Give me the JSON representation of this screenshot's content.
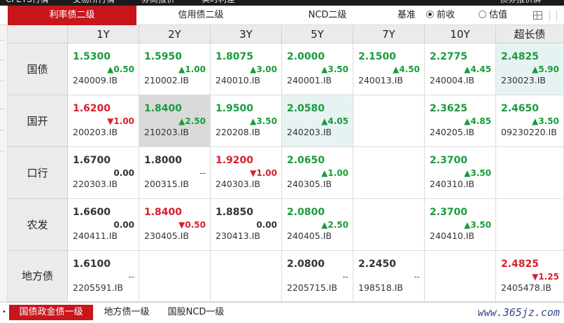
{
  "top_nav": [
    "CFETS行情",
    "交易所行情",
    "券商报价",
    "实时利差",
    "债券报价屏"
  ],
  "tabs": [
    {
      "label": "利率债二级",
      "active": true
    },
    {
      "label": "信用债二级",
      "active": false
    },
    {
      "label": "NCD二级",
      "active": false
    }
  ],
  "basis": {
    "label": "基准",
    "options": [
      {
        "label": "前收",
        "selected": true
      },
      {
        "label": "估值",
        "selected": false
      }
    ]
  },
  "columns": [
    "1Y",
    "2Y",
    "3Y",
    "5Y",
    "7Y",
    "10Y",
    "超长债"
  ],
  "rows": [
    {
      "label": "国债",
      "cells": [
        {
          "yield": "1.5300",
          "change": "▲0.50",
          "dir": "up",
          "code": "240009.IB"
        },
        {
          "yield": "1.5950",
          "change": "▲1.00",
          "dir": "up",
          "code": "210002.IB"
        },
        {
          "yield": "1.8075",
          "change": "▲3.00",
          "dir": "up",
          "code": "240010.IB"
        },
        {
          "yield": "2.0000",
          "change": "▲3.50",
          "dir": "up",
          "code": "240001.IB"
        },
        {
          "yield": "2.1500",
          "change": "▲4.50",
          "dir": "up",
          "code": "240013.IB"
        },
        {
          "yield": "2.2775",
          "change": "▲4.45",
          "dir": "up",
          "code": "240004.IB"
        },
        {
          "yield": "2.4825",
          "change": "▲5.90",
          "dir": "up",
          "code": "230023.IB",
          "hl": "teal"
        }
      ]
    },
    {
      "label": "国开",
      "cells": [
        {
          "yield": "1.6200",
          "change": "▼1.00",
          "dir": "dn",
          "code": "200203.IB"
        },
        {
          "yield": "1.8400",
          "change": "▲2.50",
          "dir": "up",
          "code": "210203.IB",
          "hl": "gray"
        },
        {
          "yield": "1.9500",
          "change": "▲3.50",
          "dir": "up",
          "code": "220208.IB"
        },
        {
          "yield": "2.0580",
          "change": "▲4.05",
          "dir": "up",
          "code": "240203.IB",
          "hl": "teal"
        },
        null,
        {
          "yield": "2.3625",
          "change": "▲4.85",
          "dir": "up",
          "code": "240205.IB"
        },
        {
          "yield": "2.4650",
          "change": "▲3.50",
          "dir": "up",
          "code": "09230220.IB"
        }
      ]
    },
    {
      "label": "口行",
      "cells": [
        {
          "yield": "1.6700",
          "change": "0.00",
          "dir": "nt",
          "code": "220303.IB"
        },
        {
          "yield": "1.8000",
          "change": "--",
          "dir": "nc",
          "code": "200315.IB"
        },
        {
          "yield": "1.9200",
          "change": "▼1.00",
          "dir": "dn",
          "code": "240303.IB"
        },
        {
          "yield": "2.0650",
          "change": "▲1.00",
          "dir": "up",
          "code": "240305.IB"
        },
        null,
        {
          "yield": "2.3700",
          "change": "▲3.50",
          "dir": "up",
          "code": "240310.IB"
        },
        null
      ]
    },
    {
      "label": "农发",
      "cells": [
        {
          "yield": "1.6600",
          "change": "0.00",
          "dir": "nt",
          "code": "240411.IB"
        },
        {
          "yield": "1.8400",
          "change": "▼0.50",
          "dir": "dn",
          "code": "230405.IB"
        },
        {
          "yield": "1.8850",
          "change": "0.00",
          "dir": "nt",
          "code": "230413.IB"
        },
        {
          "yield": "2.0800",
          "change": "▲2.50",
          "dir": "up",
          "code": "240405.IB"
        },
        null,
        {
          "yield": "2.3700",
          "change": "▲3.50",
          "dir": "up",
          "code": "240410.IB"
        },
        null
      ]
    },
    {
      "label": "地方债",
      "cells": [
        {
          "yield": "1.6100",
          "change": "--",
          "dir": "nc",
          "code": "2205591.IB"
        },
        null,
        null,
        {
          "yield": "2.0800",
          "change": "--",
          "dir": "nc",
          "code": "2205715.IB"
        },
        {
          "yield": "2.2450",
          "change": "--",
          "dir": "nc",
          "code": "198518.IB"
        },
        null,
        {
          "yield": "2.4825",
          "change": "▼1.25",
          "dir": "dn",
          "code": "2405478.IB"
        }
      ]
    }
  ],
  "bottom_tabs": [
    {
      "label": "国债政金债一级",
      "active": true
    },
    {
      "label": "地方债一级",
      "active": false
    },
    {
      "label": "国股NCD一级",
      "active": false
    }
  ],
  "watermark": "www.365jz.com",
  "colors": {
    "accent": "#c8161d",
    "up": "#1a9b3c",
    "down": "#d8202c",
    "header_bg": "#ebebeb"
  }
}
